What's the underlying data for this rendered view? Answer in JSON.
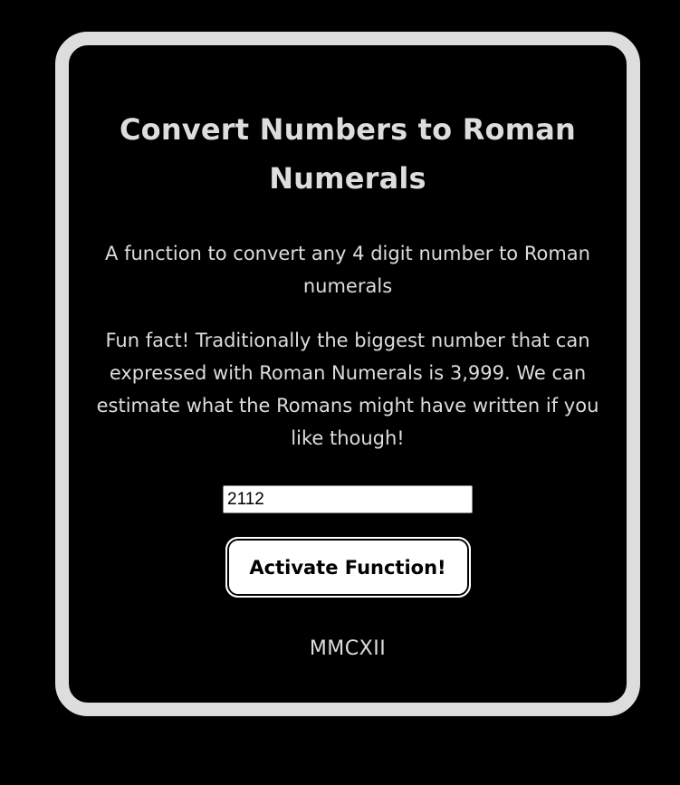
{
  "card": {
    "title": "Convert Numbers to Roman Numerals",
    "description": "A function to convert any 4 digit number to Roman numerals",
    "fun_fact": "Fun fact! Traditionally the biggest number that can expressed with Roman Numerals is 3,999. We can estimate what the Romans might have written if you like though!",
    "input": {
      "value": "2112"
    },
    "button_label": "Activate Function!",
    "result": "MMCXII"
  },
  "colors": {
    "background": "#000000",
    "card_border": "#dddddd",
    "text": "#dddddd",
    "button_bg": "#ffffff"
  }
}
